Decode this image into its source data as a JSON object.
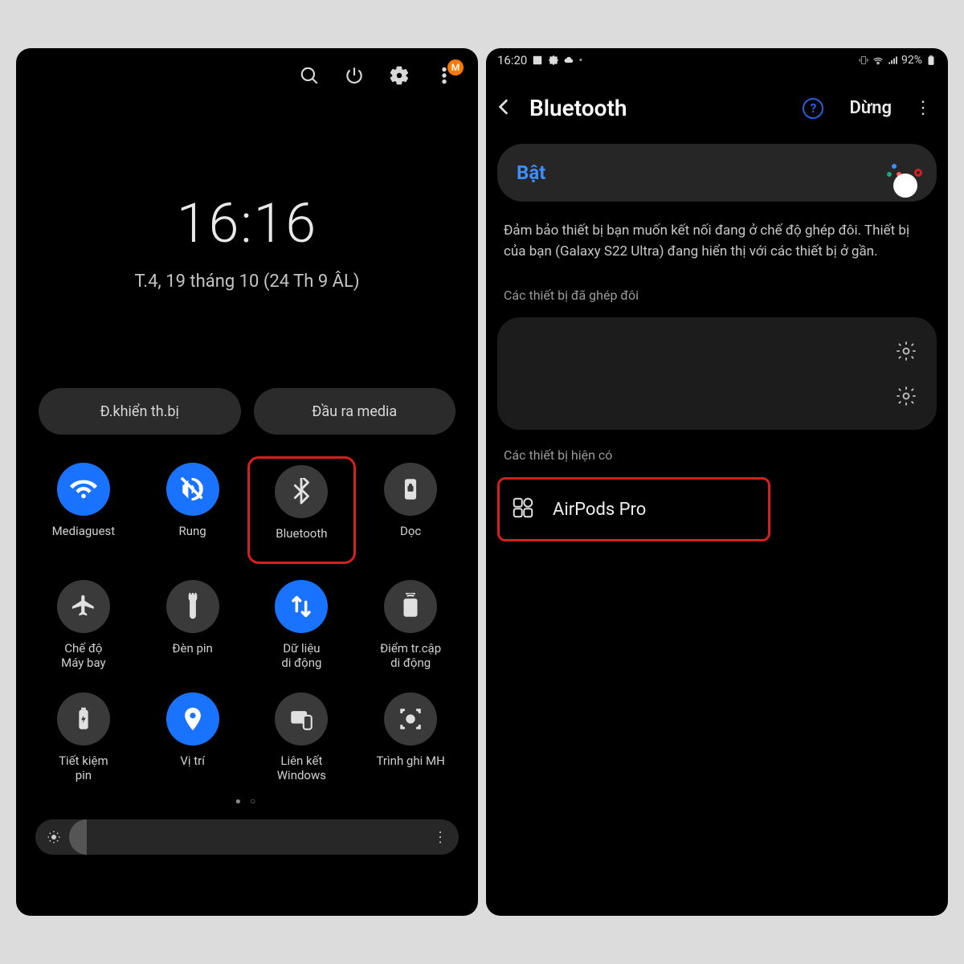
{
  "left": {
    "clock": "16:16",
    "date": "T.4, 19 tháng 10 (24 Th 9 ÂL)",
    "pills": {
      "device_control": "Đ.khiển th.bị",
      "media_output": "Đầu ra media"
    },
    "badge": "M",
    "tiles": [
      {
        "label": "Mediaguest"
      },
      {
        "label": "Rung"
      },
      {
        "label": "Bluetooth"
      },
      {
        "label": "Dọc"
      },
      {
        "label": "Chế độ\nMáy bay"
      },
      {
        "label": "Đèn pin"
      },
      {
        "label": "Dữ liệu\ndi động"
      },
      {
        "label": "Điểm tr.cập\ndi động"
      },
      {
        "label": "Tiết kiệm\npin"
      },
      {
        "label": "Vị trí"
      },
      {
        "label": "Liên kết\nWindows"
      },
      {
        "label": "Trình ghi MH"
      }
    ]
  },
  "right": {
    "status_time": "16:20",
    "battery": "92%",
    "title": "Bluetooth",
    "stop": "Dừng",
    "on_label": "Bật",
    "desc": "Đảm bảo thiết bị bạn muốn kết nối đang ở chế độ ghép đôi. Thiết bị của bạn (Galaxy S22 Ultra) đang hiển thị với các thiết bị ở gần.",
    "paired_title": "Các thiết bị đã ghép đôi",
    "available_title": "Các thiết bị hiện có",
    "available_device": "AirPods Pro"
  }
}
